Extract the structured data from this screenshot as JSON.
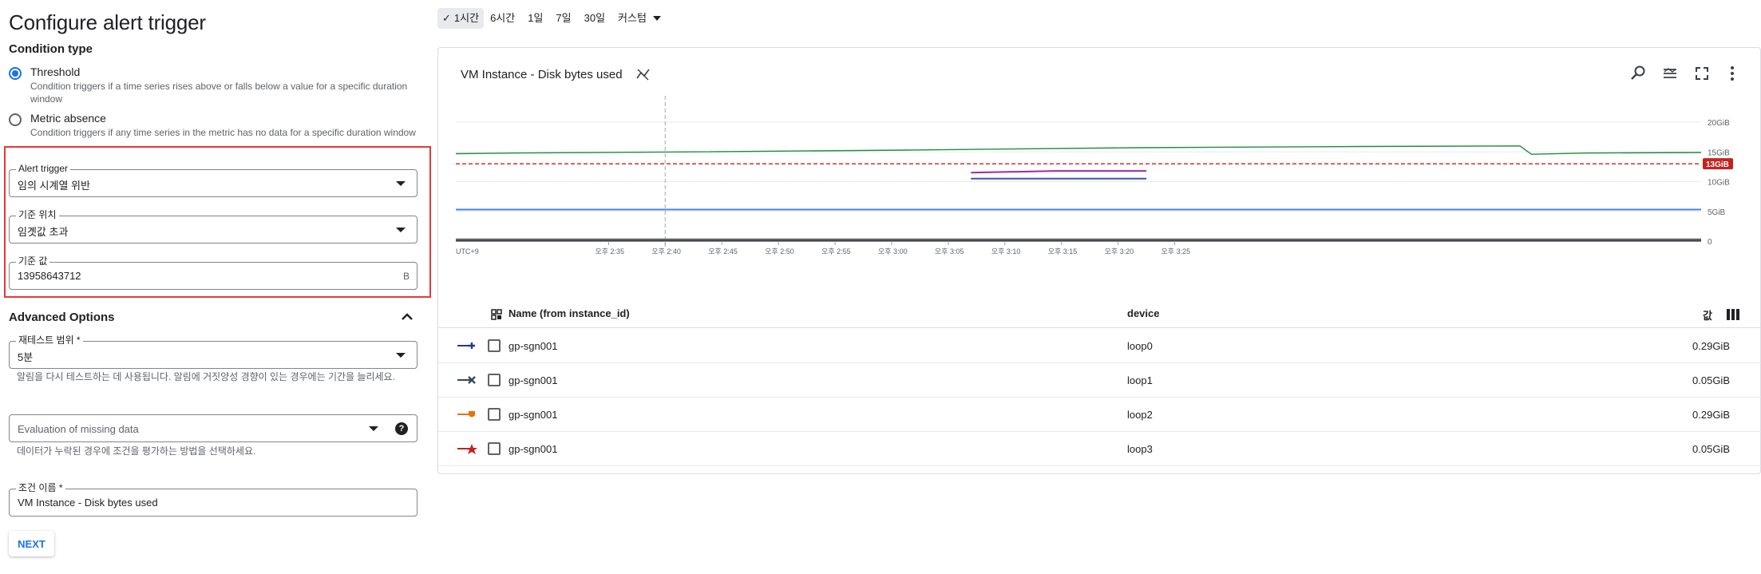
{
  "page_title": "Configure alert trigger",
  "condition_type": {
    "title": "Condition type",
    "options": [
      {
        "label": "Threshold",
        "description": "Condition triggers if a time series rises above or falls below a value for a specific duration window",
        "checked": true
      },
      {
        "label": "Metric absence",
        "description": "Condition triggers if any time series in the metric has no data for a specific duration window",
        "checked": false
      }
    ]
  },
  "alert_trigger": {
    "label": "Alert trigger",
    "value": "임의 시계열 위반"
  },
  "threshold_position": {
    "label": "기준 위치",
    "value": "임곗값 초과"
  },
  "threshold_value": {
    "label": "기준 값",
    "value": "13958643712",
    "unit": "B"
  },
  "advanced": {
    "title": "Advanced Options",
    "retest_window": {
      "label": "재테스트 범위 *",
      "value": "5분",
      "hint": "알림을 다시 테스트하는 데 사용됩니다. 알림에 거짓양성 경향이 있는 경우에는 기간을 늘리세요."
    },
    "missing_data": {
      "placeholder": "Evaluation of missing data",
      "hint": "데이터가 누락된 경우에 조건을 평가하는 방법을 선택하세요."
    },
    "condition_name": {
      "label": "조건 이름 *",
      "value": "VM Instance - Disk bytes used"
    }
  },
  "next_label": "NEXT",
  "time_range": {
    "options": [
      "1시간",
      "6시간",
      "1일",
      "7일",
      "30일",
      "커스텀"
    ],
    "selected": "1시간"
  },
  "chart_card": {
    "title": "VM Instance - Disk bytes used",
    "toolbar_icons": [
      "zoom-icon",
      "legend-toggle-icon",
      "fullscreen-icon",
      "more-vert-icon"
    ]
  },
  "chart_data": {
    "type": "line",
    "ylabel": "",
    "ylim": [
      0,
      20
    ],
    "yticks": [
      "20GiB",
      "15GiB",
      "10GiB",
      "5GiB",
      "0"
    ],
    "x": [
      "UTC+9",
      "오후 2:35",
      "오후 2:40",
      "오후 2:45",
      "오후 2:50",
      "오후 2:55",
      "오후 3:00",
      "오후 3:05",
      "오후 3:10",
      "오후 3:15",
      "오후 3:20",
      "오후 3:25"
    ],
    "threshold": {
      "value": 13,
      "label": "13GiB",
      "color": "#c5221f"
    },
    "cursor_x": "오후 2:40",
    "series": [
      {
        "color": "#1e8e3e",
        "points": [
          [
            0,
            14.7
          ],
          [
            5,
            14.8
          ],
          [
            20,
            15.0
          ],
          [
            40,
            15.3
          ],
          [
            60,
            15.7
          ],
          [
            80,
            15.9
          ],
          [
            94,
            16.0
          ],
          [
            95,
            14.6
          ],
          [
            100,
            14.8
          ],
          [
            110,
            14.9
          ]
        ]
      },
      {
        "color": "#9c27b0",
        "points": [
          [
            45.5,
            11.5
          ],
          [
            53,
            11.8
          ],
          [
            61,
            11.8
          ]
        ]
      },
      {
        "color": "#3f51b5",
        "points": [
          [
            45.5,
            10.5
          ],
          [
            61,
            10.5
          ]
        ]
      },
      {
        "color": "#4285f4",
        "points": [
          [
            0,
            5.3
          ],
          [
            110,
            5.3
          ]
        ]
      },
      {
        "color": "#5f6368",
        "points": [
          [
            0,
            0.3
          ],
          [
            110,
            0.3
          ]
        ]
      },
      {
        "color": "#3c4043",
        "points": [
          [
            0,
            0.05
          ],
          [
            110,
            0.05
          ]
        ]
      }
    ]
  },
  "table": {
    "headers": {
      "name": "Name (from instance_id)",
      "device": "device",
      "value": "값"
    },
    "rows": [
      {
        "name": "gp-sgn001",
        "device": "loop0",
        "value": "0.29GiB",
        "color": "#283593",
        "marker": "plus"
      },
      {
        "name": "gp-sgn001",
        "device": "loop1",
        "value": "0.05GiB",
        "color": "#37474f",
        "marker": "cross"
      },
      {
        "name": "gp-sgn001",
        "device": "loop2",
        "value": "0.29GiB",
        "color": "#e8710a",
        "marker": "shield"
      },
      {
        "name": "gp-sgn001",
        "device": "loop3",
        "value": "0.05GiB",
        "color": "#c5221f",
        "marker": "star"
      }
    ]
  }
}
